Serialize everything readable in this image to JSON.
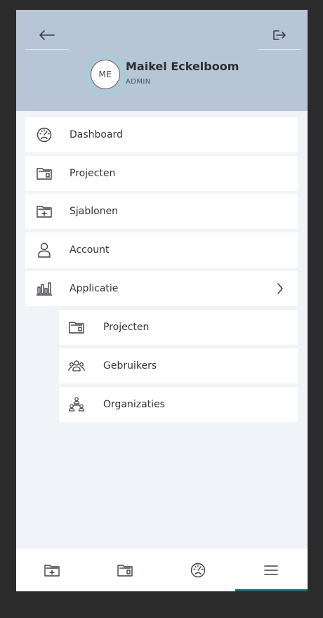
{
  "user": {
    "initials": "ME",
    "name": "Maikel Eckelboom",
    "role": "ADMIN"
  },
  "header": {
    "back_icon": "arrow-left-icon",
    "logout_icon": "logout-icon"
  },
  "menu": {
    "items": [
      {
        "label": "Dashboard",
        "icon": "dashboard-gauge-icon"
      },
      {
        "label": "Projecten",
        "icon": "folder-icon"
      },
      {
        "label": "Sjablonen",
        "icon": "folder-plus-icon"
      },
      {
        "label": "Account",
        "icon": "user-icon"
      },
      {
        "label": "Applicatie",
        "icon": "bar-chart-icon",
        "expanded": true
      }
    ],
    "subitems": [
      {
        "label": "Projecten",
        "icon": "folder-icon"
      },
      {
        "label": "Gebruikers",
        "icon": "users-icon"
      },
      {
        "label": "Organizaties",
        "icon": "organization-icon"
      }
    ]
  },
  "bottom_nav": [
    {
      "icon": "folder-plus-icon"
    },
    {
      "icon": "folder-icon"
    },
    {
      "icon": "dashboard-gauge-icon"
    },
    {
      "icon": "menu-icon",
      "active": true
    }
  ],
  "colors": {
    "header_bg": "#b8c5d6",
    "page_bg": "#f0f3f8",
    "accent": "#1f6b73",
    "avatar_ring": "#9fd2d8"
  }
}
